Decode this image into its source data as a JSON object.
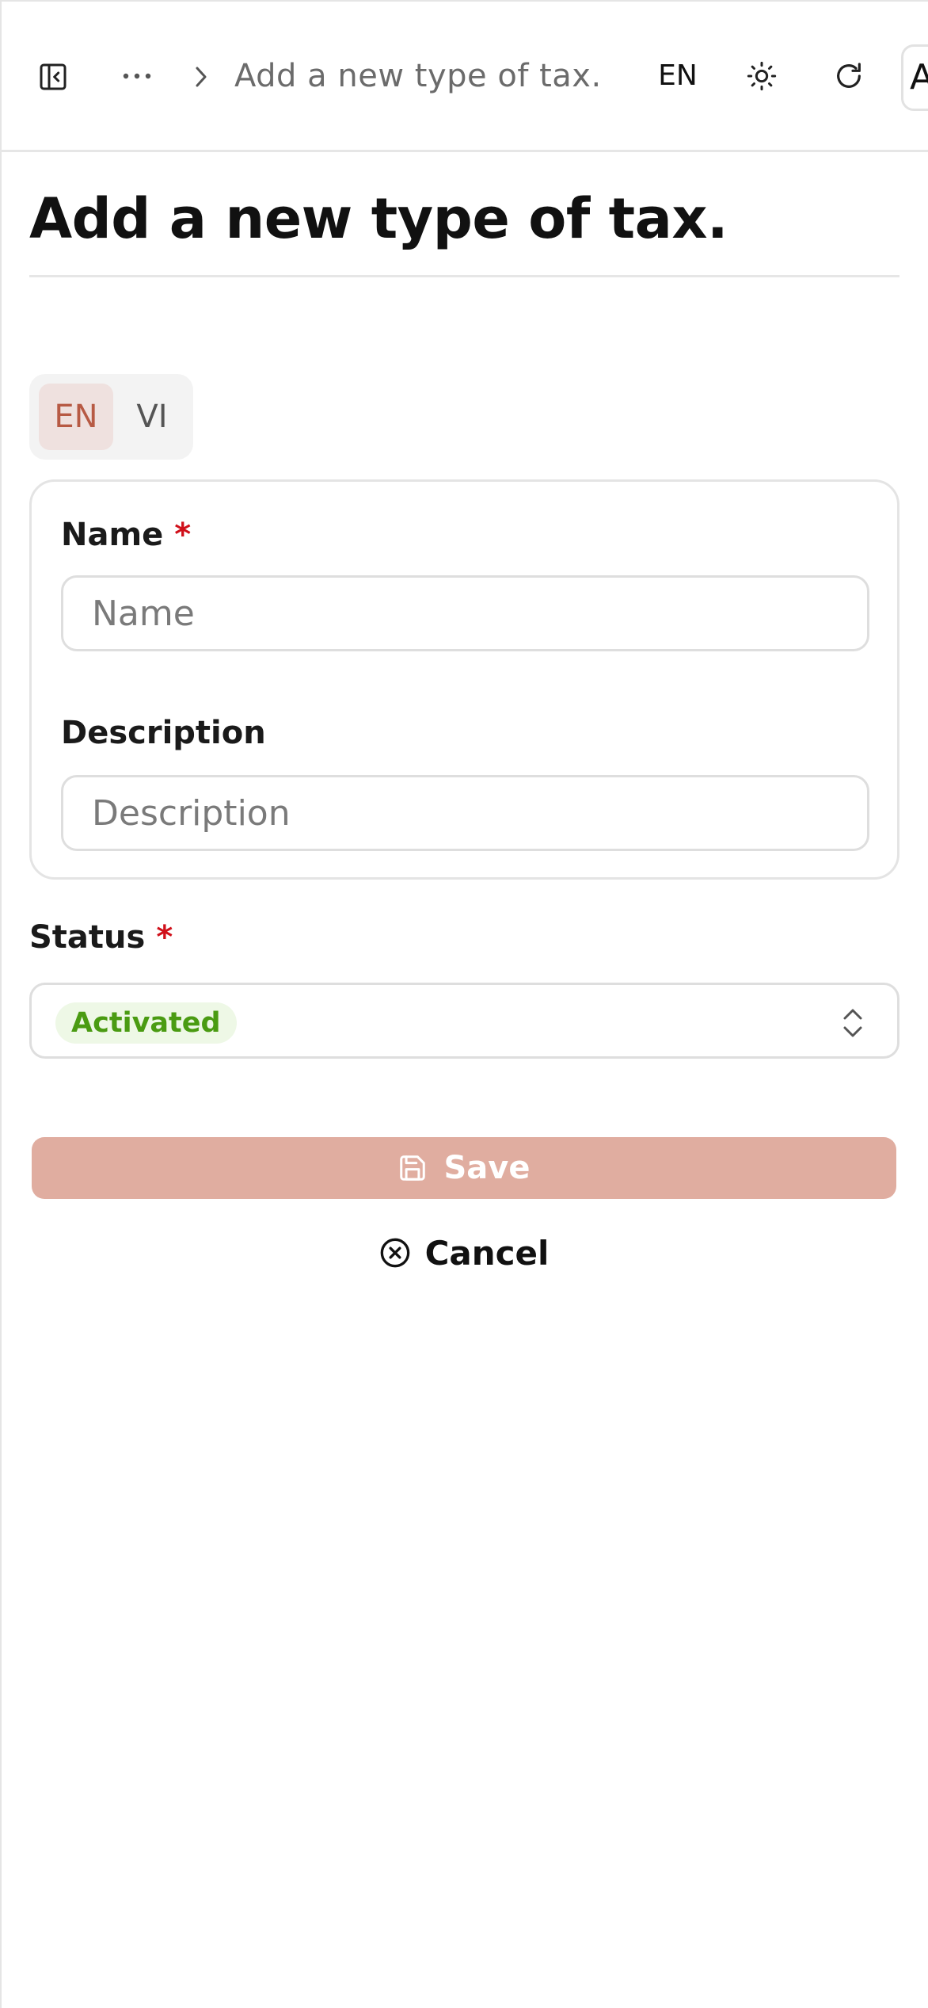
{
  "header": {
    "breadcrumb_more": "···",
    "breadcrumb_current": "Add a new type of tax.",
    "language": "EN",
    "avatar_initial": "A"
  },
  "page": {
    "title": "Add a new type of tax."
  },
  "language_tabs": [
    {
      "label": "EN",
      "active": true
    },
    {
      "label": "VI",
      "active": false
    }
  ],
  "form": {
    "name_label": "Name",
    "name_required": "*",
    "name_placeholder": "Name",
    "name_value": "",
    "description_label": "Description",
    "description_placeholder": "Description",
    "description_value": "",
    "status_label": "Status",
    "status_required": "*",
    "status_value": "Activated"
  },
  "actions": {
    "save_label": "Save",
    "cancel_label": "Cancel"
  },
  "colors": {
    "accent": "#B75A44",
    "save_button_disabled": "#E0ADA0",
    "status_activated_text": "#4A9B12",
    "status_activated_bg": "#EEF8E6",
    "required_mark": "#D0101A"
  },
  "icons": {
    "sidebar": "sidebar-toggle-icon",
    "more": "ellipsis-icon",
    "chevron": "chevron-right-icon",
    "theme": "sun-icon",
    "refresh": "refresh-icon",
    "select": "chevrons-up-down-icon",
    "save": "floppy-disk-icon",
    "cancel": "circle-x-icon"
  }
}
